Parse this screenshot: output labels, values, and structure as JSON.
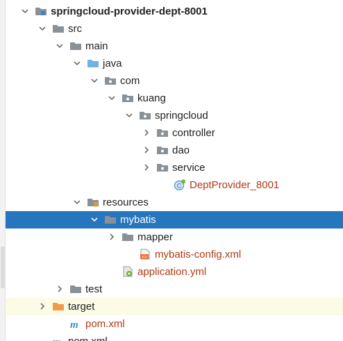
{
  "tree": {
    "items": [
      {
        "label": "springcloud-provider-dept-8001",
        "icon": "module-folder-icon",
        "arrow": "chevron-down-icon",
        "level": 0,
        "style": "bold"
      },
      {
        "label": "src",
        "icon": "folder-icon",
        "arrow": "chevron-down-icon",
        "level": 1
      },
      {
        "label": "main",
        "icon": "folder-icon",
        "arrow": "chevron-down-icon",
        "level": 2
      },
      {
        "label": "java",
        "icon": "source-folder-icon",
        "arrow": "chevron-down-icon",
        "level": 3
      },
      {
        "label": "com",
        "icon": "package-icon",
        "arrow": "chevron-down-icon",
        "level": 4
      },
      {
        "label": "kuang",
        "icon": "package-icon",
        "arrow": "chevron-down-icon",
        "level": 5
      },
      {
        "label": "springcloud",
        "icon": "package-icon",
        "arrow": "chevron-down-icon",
        "level": 6
      },
      {
        "label": "controller",
        "icon": "package-icon",
        "arrow": "chevron-right-icon",
        "level": 7
      },
      {
        "label": "dao",
        "icon": "package-icon",
        "arrow": "chevron-right-icon",
        "level": 7
      },
      {
        "label": "service",
        "icon": "package-icon",
        "arrow": "chevron-right-icon",
        "level": 7
      },
      {
        "label": "DeptProvider_8001",
        "icon": "spring-boot-class-icon",
        "arrow": "",
        "level": 8,
        "style": "red"
      },
      {
        "label": "resources",
        "icon": "resources-folder-icon",
        "arrow": "chevron-down-icon",
        "level": 3
      },
      {
        "label": "mybatis",
        "icon": "folder-icon",
        "arrow": "chevron-down-icon",
        "level": 4,
        "selected": true
      },
      {
        "label": "mapper",
        "icon": "folder-icon",
        "arrow": "chevron-right-icon",
        "level": 5
      },
      {
        "label": "mybatis-config.xml",
        "icon": "xml-file-icon",
        "arrow": "",
        "level": 6,
        "style": "red"
      },
      {
        "label": "application.yml",
        "icon": "yaml-file-icon",
        "arrow": "",
        "level": 5,
        "style": "red"
      },
      {
        "label": "test",
        "icon": "folder-icon",
        "arrow": "chevron-right-icon",
        "level": 2
      },
      {
        "label": "target",
        "icon": "excluded-folder-icon",
        "arrow": "chevron-right-icon",
        "level": 1,
        "ignored": true
      },
      {
        "label": "pom.xml",
        "icon": "maven-pom-icon",
        "arrow": "",
        "level": 2,
        "style": "red"
      },
      {
        "label": "pom.xml",
        "icon": "maven-pom-icon",
        "arrow": "",
        "level": 1
      }
    ]
  },
  "colors": {
    "selection": "#2675bf",
    "ignored_row": "#fbfbe6",
    "modified_text": "#b23a14",
    "folder": "#8a9196",
    "source_folder": "#6fb3e0",
    "excluded_folder": "#f29a4a"
  }
}
